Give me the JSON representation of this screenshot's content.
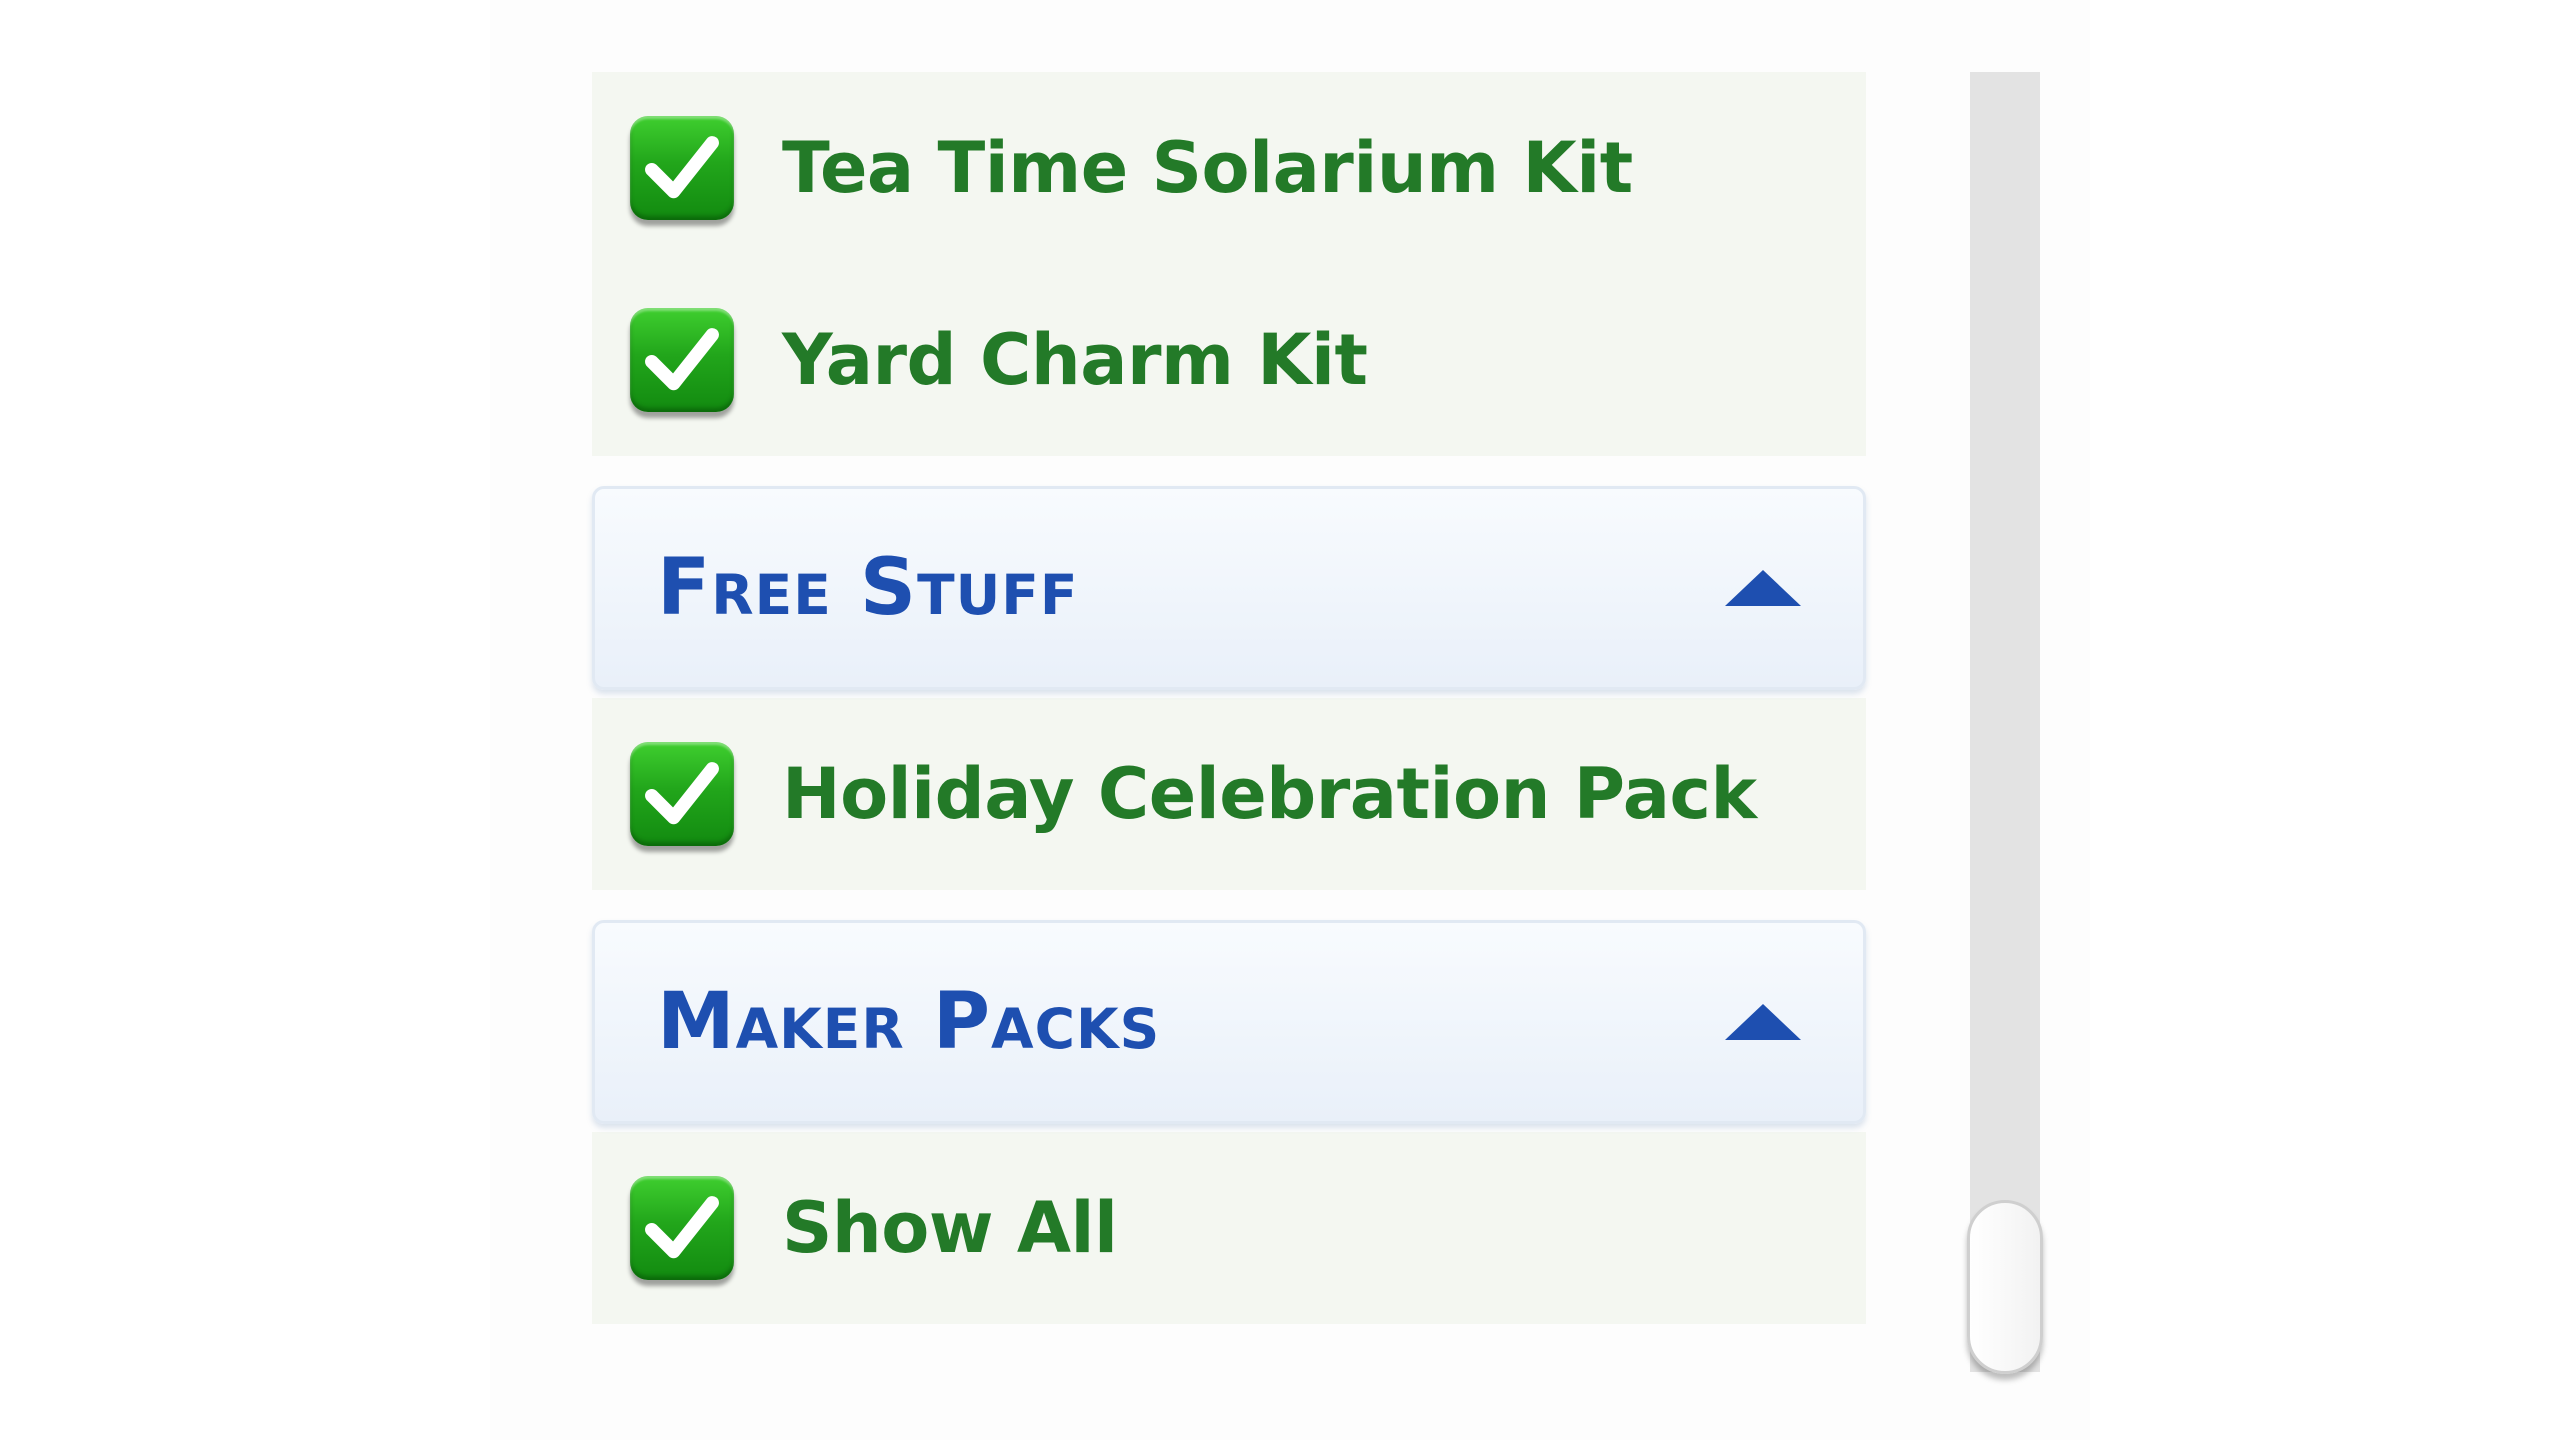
{
  "accent_colors": {
    "checkbox_green": "#22a61b",
    "item_text_green": "#237a28",
    "header_blue": "#1e4fb0"
  },
  "top_items": [
    {
      "label": "Tea Time Solarium Kit",
      "checked": true,
      "icon": "checkmark-icon"
    },
    {
      "label": "Yard Charm Kit",
      "checked": true,
      "icon": "checkmark-icon"
    }
  ],
  "sections": [
    {
      "title": "Free Stuff",
      "expanded": true,
      "icon": "chevron-up-icon",
      "items": [
        {
          "label": "Holiday Celebration Pack",
          "checked": true,
          "icon": "checkmark-icon"
        }
      ]
    },
    {
      "title": "Maker Packs",
      "expanded": true,
      "icon": "chevron-up-icon",
      "items": [
        {
          "label": "Show All",
          "checked": true,
          "icon": "checkmark-icon"
        }
      ]
    }
  ],
  "scrollbar": {
    "scroll_position": 1.0
  }
}
